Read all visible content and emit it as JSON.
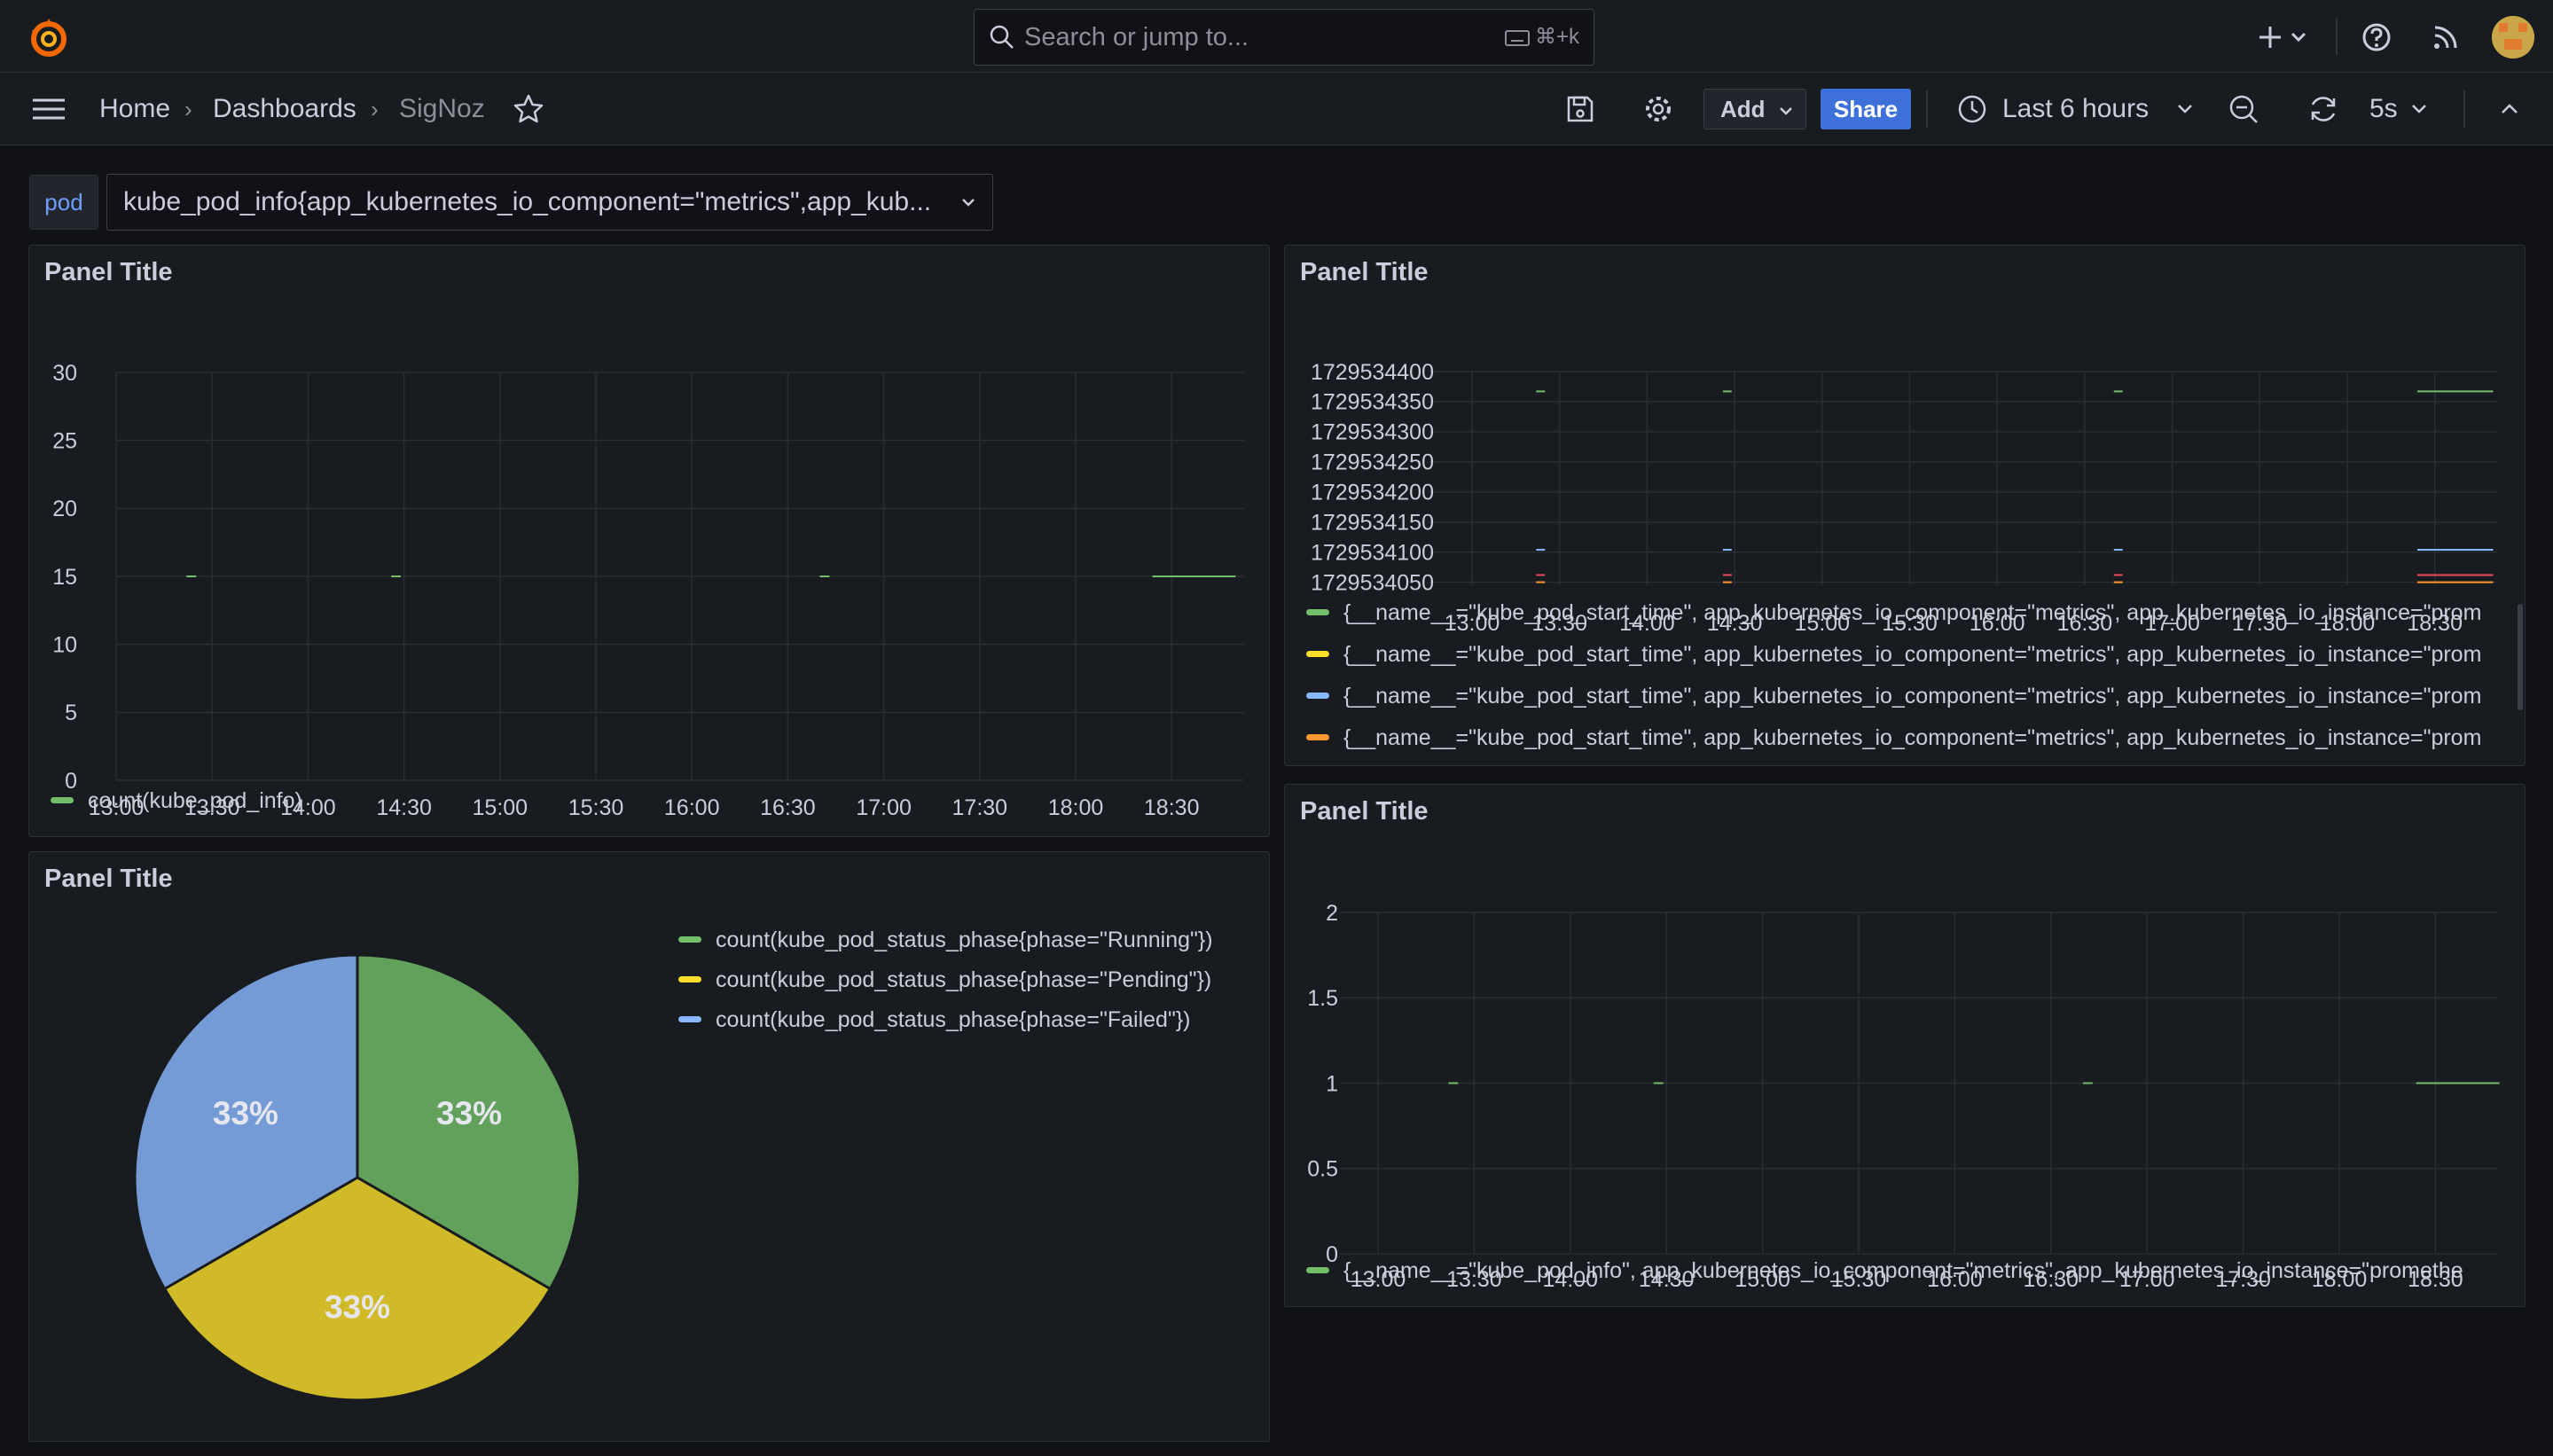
{
  "topbar": {
    "search_placeholder": "Search or jump to...",
    "search_shortcut": "⌘+k",
    "icons": [
      "grafana-logo-icon",
      "search-icon",
      "keyboard-icon",
      "plus-icon",
      "chevron-down-icon",
      "help-icon",
      "rss-icon",
      "avatar"
    ]
  },
  "navbar": {
    "breadcrumbs": [
      "Home",
      "Dashboards",
      "SigNoz"
    ],
    "add_label": "Add",
    "share_label": "Share",
    "time_range": "Last 6 hours",
    "refresh_interval": "5s"
  },
  "variables": {
    "label": "pod",
    "value": "kube_pod_info{app_kubernetes_io_component=\"metrics\",app_kub..."
  },
  "colors": {
    "green": "#73bf69",
    "yellow": "#fade2a",
    "blue": "#8ab8ff",
    "red": "#f2495c",
    "orange": "#ff9830",
    "accent": "#3d71d9"
  },
  "panels": [
    {
      "title": "Panel Title",
      "chart_data": {
        "type": "line",
        "x_ticks": [
          "13:00",
          "13:30",
          "14:00",
          "14:30",
          "15:00",
          "15:30",
          "16:00",
          "16:30",
          "17:00",
          "17:30",
          "18:00",
          "18:30"
        ],
        "y_ticks": [
          "0",
          "5",
          "10",
          "15",
          "20",
          "25",
          "30"
        ],
        "ylim": [
          0,
          30
        ],
        "series": [
          {
            "name": "count(kube_pod_info)",
            "color": "#73bf69",
            "segments": [
              [
                "13:22",
                "13:25",
                15
              ],
              [
                "14:26",
                "14:29",
                15
              ],
              [
                "16:40",
                "16:43",
                15
              ],
              [
                "18:24",
                "18:50",
                15
              ]
            ]
          }
        ]
      }
    },
    {
      "title": "Panel Title",
      "chart_data": {
        "type": "line",
        "x_ticks": [
          "13:00",
          "13:30",
          "14:00",
          "14:30",
          "15:00",
          "15:30",
          "16:00",
          "16:30",
          "17:00",
          "17:30",
          "18:00",
          "18:30"
        ],
        "y_ticks": [
          "1729534050",
          "1729534100",
          "1729534150",
          "1729534200",
          "1729534250",
          "1729534300",
          "1729534350",
          "1729534400"
        ],
        "ylim": [
          1729534045,
          1729534400
        ],
        "series": [
          {
            "name": "{__name__=\"kube_pod_start_time\", app_kubernetes_io_component=\"metrics\", app_kubernetes_io_instance=\"prom",
            "color": "#73bf69",
            "segments": [
              [
                "13:22",
                "13:25",
                1729534367
              ],
              [
                "14:26",
                "14:29",
                1729534367
              ],
              [
                "16:40",
                "16:43",
                1729534367
              ],
              [
                "18:24",
                "18:50",
                1729534367
              ]
            ]
          },
          {
            "name": "{__name__=\"kube_pod_start_time\", app_kubernetes_io_component=\"metrics\", app_kubernetes_io_instance=\"prom",
            "color": "#fade2a",
            "segments": []
          },
          {
            "name": "{__name__=\"kube_pod_start_time\", app_kubernetes_io_component=\"metrics\", app_kubernetes_io_instance=\"prom",
            "color": "#8ab8ff",
            "segments": [
              [
                "13:22",
                "13:25",
                1729534104
              ],
              [
                "14:26",
                "14:29",
                1729534104
              ],
              [
                "16:40",
                "16:43",
                1729534104
              ],
              [
                "18:24",
                "18:50",
                1729534104
              ]
            ]
          },
          {
            "name": "{__name__=\"kube_pod_start_time\", app_kubernetes_io_component=\"metrics\", app_kubernetes_io_instance=\"prom",
            "color": "#ff9830",
            "segments": [
              [
                "13:22",
                "13:25",
                1729534050
              ],
              [
                "14:26",
                "14:29",
                1729534050
              ],
              [
                "16:40",
                "16:43",
                1729534050
              ],
              [
                "18:24",
                "18:50",
                1729534050
              ]
            ]
          },
          {
            "name": "",
            "color": "#f2495c",
            "segments": [
              [
                "13:22",
                "13:25",
                1729534062
              ],
              [
                "14:26",
                "14:29",
                1729534062
              ],
              [
                "16:40",
                "16:43",
                1729534062
              ],
              [
                "18:24",
                "18:50",
                1729534062
              ]
            ]
          }
        ]
      }
    },
    {
      "title": "Panel Title",
      "chart_data": {
        "type": "pie",
        "labels": [
          "count(kube_pod_status_phase{phase=\"Running\"})",
          "count(kube_pod_status_phase{phase=\"Pending\"})",
          "count(kube_pod_status_phase{phase=\"Failed\"})"
        ],
        "values": [
          1,
          1,
          1
        ],
        "percent_labels": [
          "33%",
          "33%",
          "33%"
        ],
        "colors": [
          "#73bf69",
          "#fade2a",
          "#8ab8ff"
        ],
        "legend": "right"
      }
    },
    {
      "title": "Panel Title",
      "chart_data": {
        "type": "line",
        "x_ticks": [
          "13:00",
          "13:30",
          "14:00",
          "14:30",
          "15:00",
          "15:30",
          "16:00",
          "16:30",
          "17:00",
          "17:30",
          "18:00",
          "18:30"
        ],
        "y_ticks": [
          "0",
          "0.5",
          "1",
          "1.5",
          "2"
        ],
        "ylim": [
          0,
          2
        ],
        "series": [
          {
            "name": "{__name__=\"kube_pod_info\", app_kubernetes_io_component=\"metrics\", app_kubernetes_io_instance=\"promethe",
            "color": "#73bf69",
            "segments": [
              [
                "13:22",
                "13:25",
                1
              ],
              [
                "14:26",
                "14:29",
                1
              ],
              [
                "16:40",
                "16:43",
                1
              ],
              [
                "18:24",
                "18:50",
                1
              ]
            ]
          }
        ]
      }
    }
  ]
}
